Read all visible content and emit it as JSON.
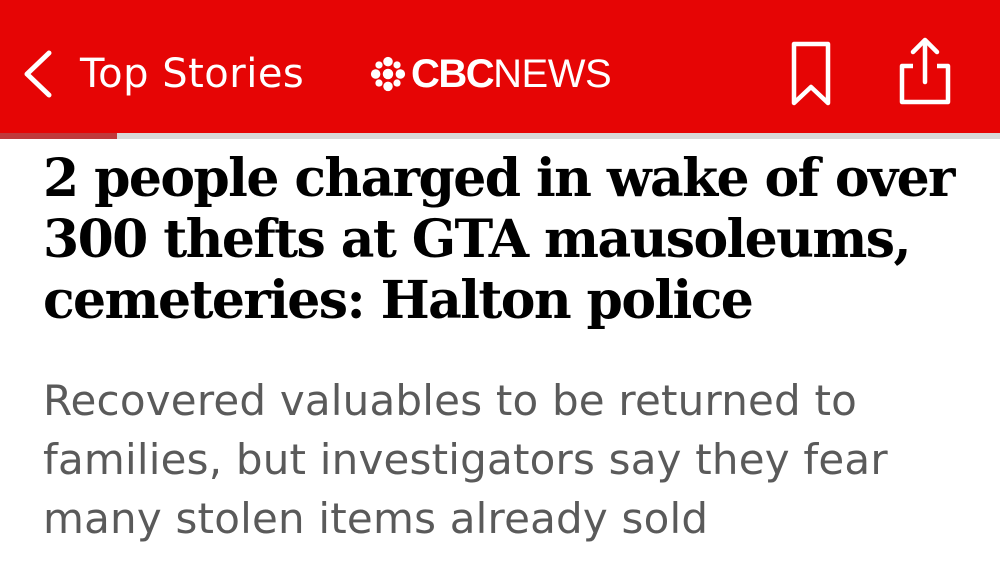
{
  "nav": {
    "back_label": "Top Stories",
    "back_icon": "chevron-left-icon",
    "brand_logo_icon": "cbc-gem-icon",
    "brand_cbc": "CBC",
    "brand_news": "NEWS",
    "bookmark_icon": "bookmark-icon",
    "share_icon": "share-icon",
    "background_color": "#e60505"
  },
  "reading_progress": 0.117,
  "article": {
    "headline": "2 people charged in wake of over 300 thefts at GTA mausoleums, cemeteries: Halton police",
    "dek": "Recovered valuables to be returned to families, but investigators say they fear many stolen items already sold"
  }
}
